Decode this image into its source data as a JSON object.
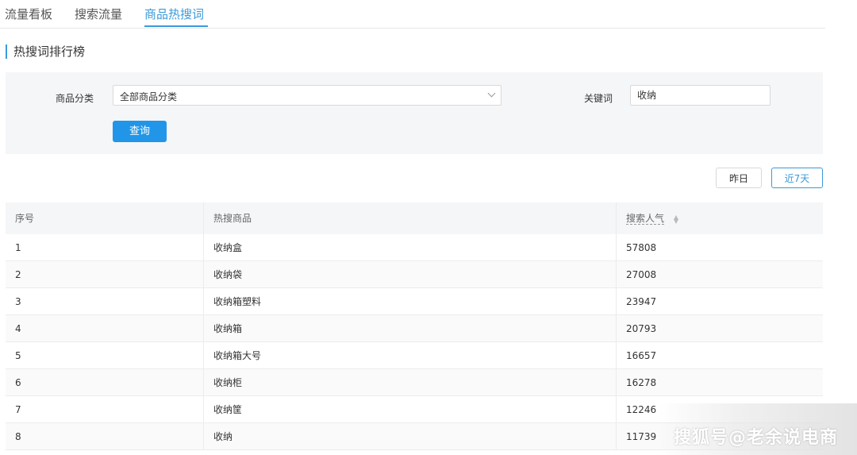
{
  "tabs": [
    {
      "label": "流量看板"
    },
    {
      "label": "搜索流量"
    },
    {
      "label": "商品热搜词"
    }
  ],
  "section_title": "热搜词排行榜",
  "filters": {
    "category_label": "商品分类",
    "category_value": "全部商品分类",
    "keyword_label": "关键词",
    "keyword_value": "收纳",
    "query_button": "查询"
  },
  "range_buttons": {
    "yesterday": "昨日",
    "last7": "近7天"
  },
  "table": {
    "headers": [
      "序号",
      "热搜商品",
      "搜索人气"
    ],
    "rows": [
      {
        "rank": "1",
        "item": "收纳盒",
        "popularity": "57808"
      },
      {
        "rank": "2",
        "item": "收纳袋",
        "popularity": "27008"
      },
      {
        "rank": "3",
        "item": "收纳箱塑料",
        "popularity": "23947"
      },
      {
        "rank": "4",
        "item": "收纳箱",
        "popularity": "20793"
      },
      {
        "rank": "5",
        "item": "收纳箱大号",
        "popularity": "16657"
      },
      {
        "rank": "6",
        "item": "收纳柜",
        "popularity": "16278"
      },
      {
        "rank": "7",
        "item": "收纳筐",
        "popularity": "12246"
      },
      {
        "rank": "8",
        "item": "收纳",
        "popularity": "11739"
      }
    ]
  },
  "watermark": "搜狐号@老余说电商",
  "colors": {
    "accent": "#3a9ad9",
    "button": "#2196e8",
    "panel": "#f5f6f8"
  }
}
